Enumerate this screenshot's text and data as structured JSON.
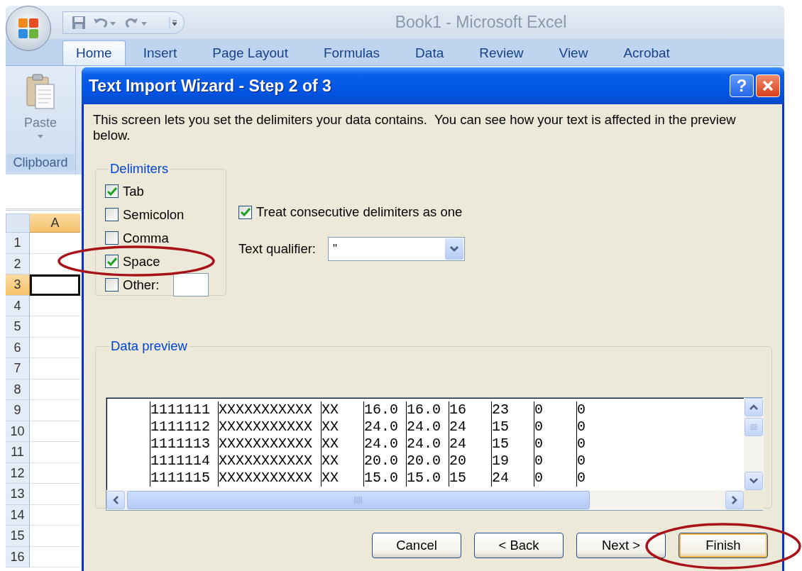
{
  "excel": {
    "title": "Book1 - Microsoft Excel",
    "ribbon_tabs": [
      {
        "label": "Home",
        "selected": true
      },
      {
        "label": "Insert",
        "selected": false
      },
      {
        "label": "Page Layout",
        "selected": false
      },
      {
        "label": "Formulas",
        "selected": false
      },
      {
        "label": "Data",
        "selected": false
      },
      {
        "label": "Review",
        "selected": false
      },
      {
        "label": "View",
        "selected": false
      },
      {
        "label": "Acrobat",
        "selected": false
      }
    ],
    "ribbon": {
      "paste_label": "Paste",
      "group_label": "Clipboard"
    },
    "sheet": {
      "columns": [
        {
          "label": "A",
          "selected": true
        }
      ],
      "rows": [
        {
          "label": "1",
          "selected": false
        },
        {
          "label": "2",
          "selected": false
        },
        {
          "label": "3",
          "selected": true
        },
        {
          "label": "4",
          "selected": false
        },
        {
          "label": "5",
          "selected": false
        },
        {
          "label": "6",
          "selected": false
        },
        {
          "label": "7",
          "selected": false
        },
        {
          "label": "8",
          "selected": false
        },
        {
          "label": "9",
          "selected": false
        },
        {
          "label": "10",
          "selected": false
        },
        {
          "label": "11",
          "selected": false
        },
        {
          "label": "12",
          "selected": false
        },
        {
          "label": "13",
          "selected": false
        },
        {
          "label": "14",
          "selected": false
        },
        {
          "label": "15",
          "selected": false
        },
        {
          "label": "16",
          "selected": false
        }
      ]
    }
  },
  "dialog": {
    "title": "Text Import Wizard - Step 2 of 3",
    "help": "?",
    "description": "This screen lets you set the delimiters your data contains.  You can see how your text is affected in the preview below.",
    "delimiters": {
      "label": "Delimiters",
      "options": [
        {
          "label": "Tab",
          "checked": true
        },
        {
          "label": "Semicolon",
          "checked": false
        },
        {
          "label": "Comma",
          "checked": false
        },
        {
          "label": "Space",
          "checked": true
        },
        {
          "label": "Other:",
          "checked": false
        }
      ]
    },
    "consecutive": {
      "label": "Treat consecutive delimiters as one",
      "checked": true
    },
    "qualifier": {
      "label": "Text qualifier:",
      "value": "\""
    },
    "preview": {
      "label": "Data preview",
      "rows": [
        [
          "1111111",
          "XXXXXXXXXXX",
          "XX",
          "16.0",
          "16.0",
          "16",
          "23",
          "0",
          "0"
        ],
        [
          "1111112",
          "XXXXXXXXXXX",
          "XX",
          "24.0",
          "24.0",
          "24",
          "15",
          "0",
          "0"
        ],
        [
          "1111113",
          "XXXXXXXXXXX",
          "XX",
          "24.0",
          "24.0",
          "24",
          "15",
          "0",
          "0"
        ],
        [
          "1111114",
          "XXXXXXXXXXX",
          "XX",
          "20.0",
          "20.0",
          "20",
          "19",
          "0",
          "0"
        ],
        [
          "1111115",
          "XXXXXXXXXXX",
          "XX",
          "15.0",
          "15.0",
          "15",
          "24",
          "0",
          "0"
        ]
      ]
    },
    "buttons": [
      {
        "label": "Cancel",
        "default": false
      },
      {
        "label": "< Back",
        "default": false
      },
      {
        "label": "Next >",
        "default": false
      },
      {
        "label": "Finish",
        "default": true
      }
    ]
  }
}
